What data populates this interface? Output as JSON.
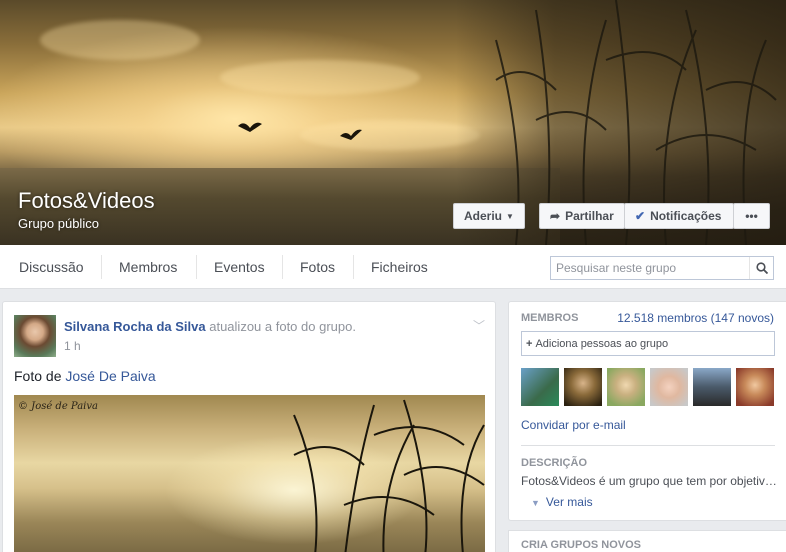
{
  "group": {
    "name": "Fotos&Videos",
    "privacy": "Grupo público"
  },
  "cover_buttons": {
    "joined": "Aderiu",
    "share": "Partilhar",
    "notifications": "Notificações",
    "more": "•••"
  },
  "nav": {
    "tabs": [
      "Discussão",
      "Membros",
      "Eventos",
      "Fotos",
      "Ficheiros"
    ],
    "search_placeholder": "Pesquisar neste grupo"
  },
  "post": {
    "author": "Silvana Rocha da Silva",
    "action": " atualizou a foto do grupo.",
    "time": "1 h",
    "text_prefix": "Foto de ",
    "photo_credit_link": "José De Paiva",
    "watermark": "© José de Paiva"
  },
  "sidebar": {
    "members_label": "MEMBROS",
    "members_count": "12.518 membros (147 novos)",
    "add_people": "Adiciona pessoas ao grupo",
    "invite_email": "Convidar por e-mail",
    "description_label": "DESCRIÇÃO",
    "description_text": "Fotos&Videos é um grupo que tem por objetivo...",
    "see_more": "Ver mais",
    "create_groups_label": "CRIA GRUPOS NOVOS"
  },
  "colors": {
    "link": "#365899",
    "muted": "#90949c",
    "page_bg": "#e9ebee"
  }
}
